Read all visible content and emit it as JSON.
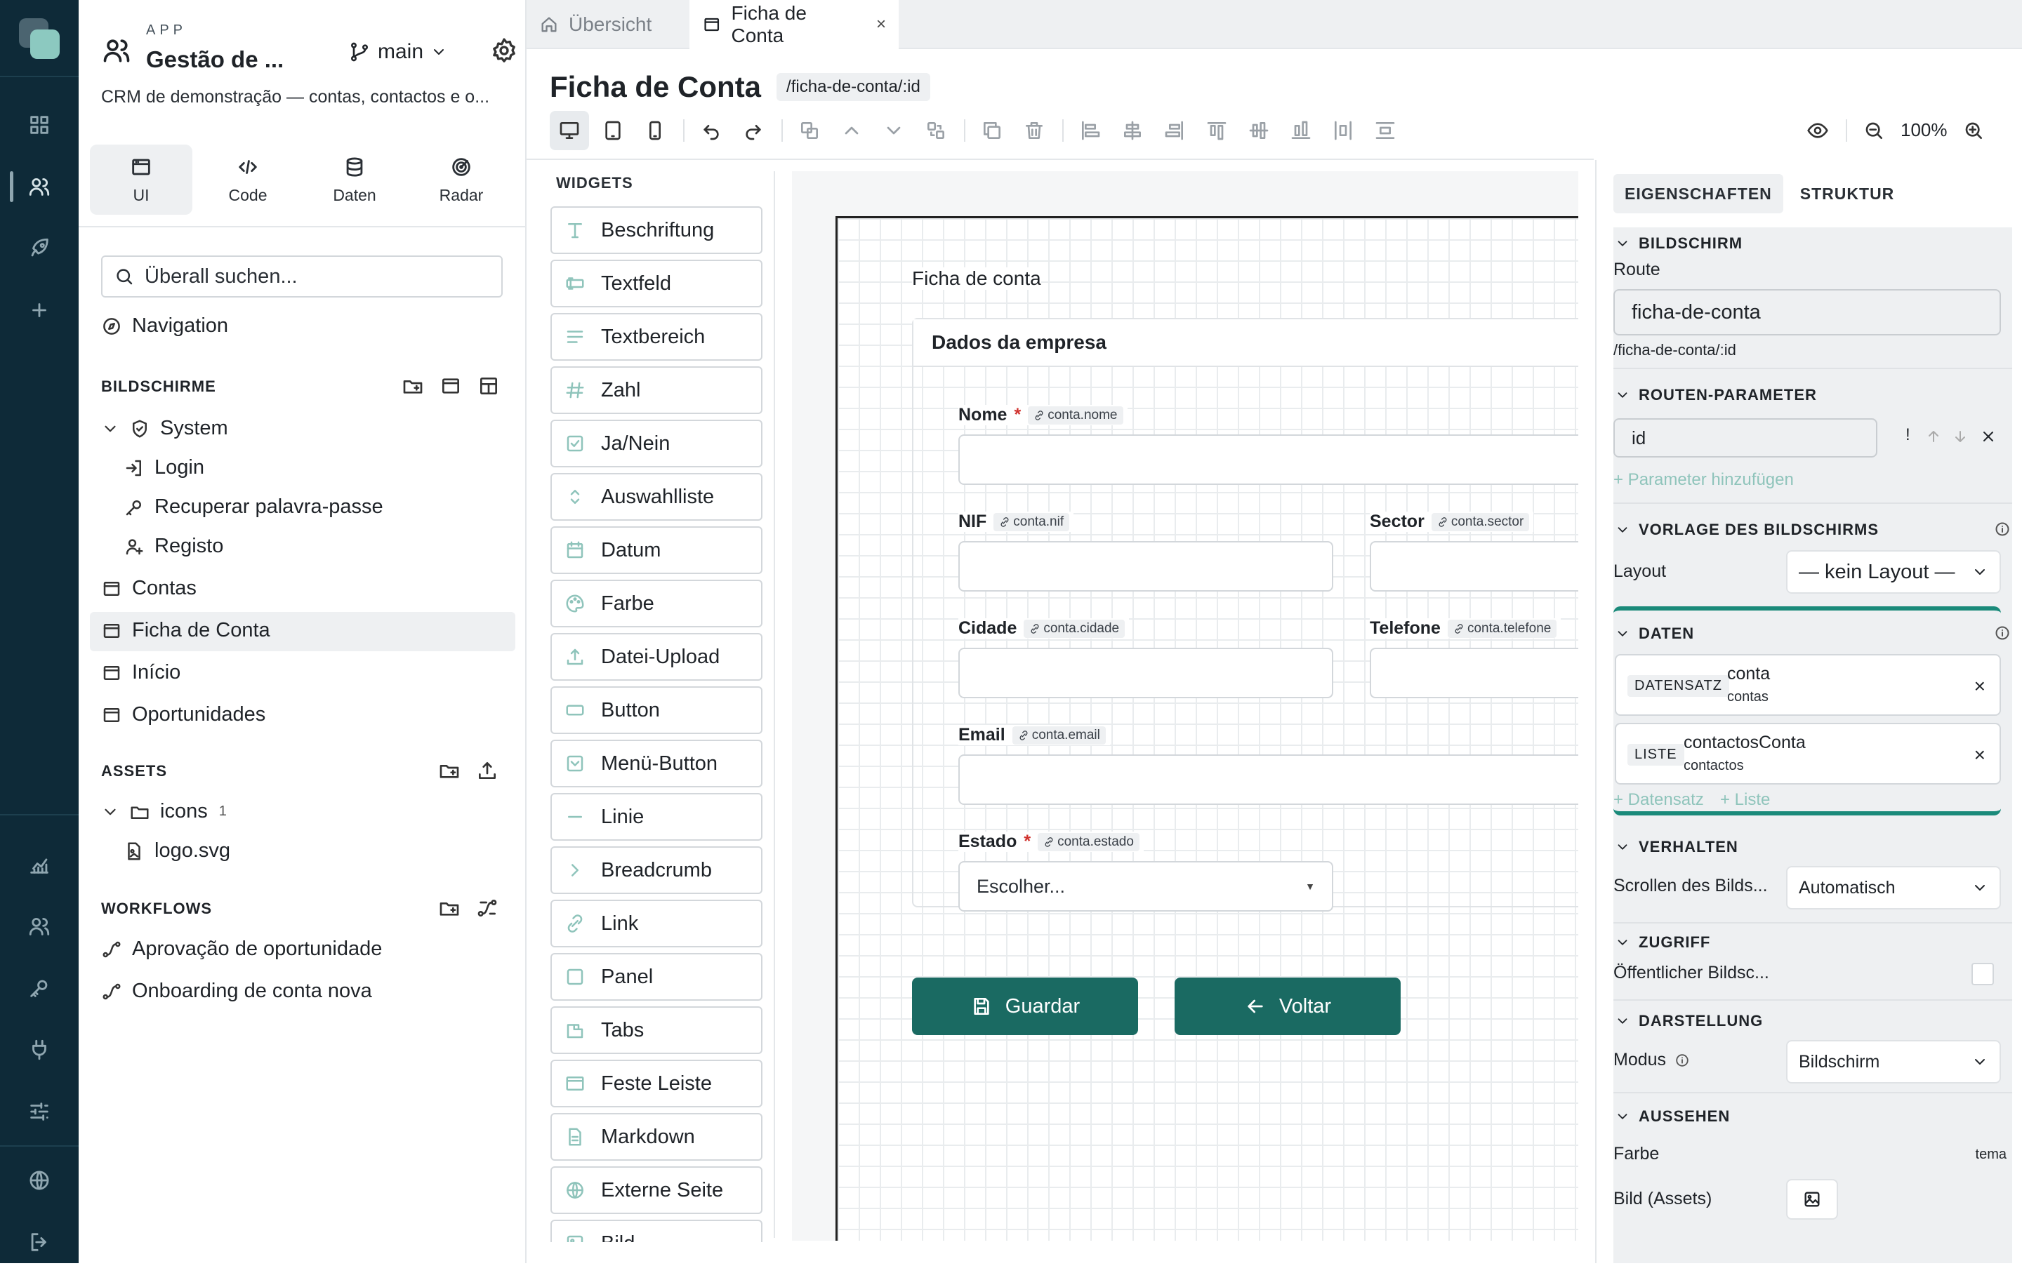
{
  "sidebar": {
    "app_label": "APP",
    "app_name": "Gestão de ...",
    "branch": "main",
    "description": "CRM de demonstração — contas, contactos e o...",
    "modes": [
      "UI",
      "Code",
      "Daten",
      "Radar"
    ],
    "search_placeholder": "Überall suchen...",
    "navigation": "Navigation",
    "screens_title": "BILDSCHIRME",
    "system_folder": "System",
    "system_items": [
      "Login",
      "Recuperar palavra-passe",
      "Registo"
    ],
    "screens": [
      "Contas",
      "Ficha de Conta",
      "Início",
      "Oportunidades"
    ],
    "assets_title": "ASSETS",
    "icons_folder": "icons",
    "icons_count": "1",
    "asset_file": "logo.svg",
    "workflows_title": "WORKFLOWS",
    "workflows": [
      "Aprovação de oportunidade",
      "Onboarding de conta nova"
    ]
  },
  "tabs": [
    {
      "label": "Übersicht"
    },
    {
      "label": "Ficha de Conta",
      "close": "×"
    }
  ],
  "page": {
    "title": "Ficha de Conta",
    "route": "/ficha-de-conta/:id",
    "zoom": "100%"
  },
  "widgets": {
    "title": "WIDGETS",
    "items": [
      "Beschriftung",
      "Textfeld",
      "Textbereich",
      "Zahl",
      "Ja/Nein",
      "Auswahlliste",
      "Datum",
      "Farbe",
      "Datei-Upload",
      "Button",
      "Menü-Button",
      "Linie",
      "Breadcrumb",
      "Link",
      "Panel",
      "Tabs",
      "Feste Leiste",
      "Markdown",
      "Externe Seite",
      "Bild"
    ]
  },
  "canvas": {
    "heading": "Ficha de conta",
    "card_title": "Dados da empresa",
    "fields": {
      "nome": {
        "label": "Nome",
        "bind": "conta.nome"
      },
      "nif": {
        "label": "NIF",
        "bind": "conta.nif"
      },
      "sector": {
        "label": "Sector",
        "bind": "conta.sector"
      },
      "cidade": {
        "label": "Cidade",
        "bind": "conta.cidade"
      },
      "telefone": {
        "label": "Telefone",
        "bind": "conta.telefone"
      },
      "email": {
        "label": "Email",
        "bind": "conta.email"
      },
      "estado": {
        "label": "Estado",
        "bind": "conta.estado",
        "placeholder": "Escolher..."
      }
    },
    "required_mark": "*",
    "save_button": "Guardar",
    "back_button": "Voltar"
  },
  "properties": {
    "tabs": [
      "EIGENSCHAFTEN",
      "STRUKTUR"
    ],
    "screen_section": "BILDSCHIRM",
    "route_label": "Route",
    "route_value": "ficha-de-conta",
    "route_full": "/ficha-de-conta/:id",
    "params_section": "ROUTEN-PARAMETER",
    "param_value": "id",
    "param_flag": "!",
    "add_param": "+ Parameter hinzufügen",
    "template_section": "VORLAGE DES BILDSCHIRMS",
    "layout_label": "Layout",
    "layout_value": "— kein Layout —",
    "data_section": "DATEN",
    "data_items": [
      {
        "tag": "DATENSATZ",
        "name": "conta",
        "source": "contas"
      },
      {
        "tag": "LISTE",
        "name": "contactosConta",
        "source": "contactos"
      }
    ],
    "add_record": "+ Datensatz",
    "add_list": "+ Liste",
    "behavior_section": "VERHALTEN",
    "scroll_label": "Scrollen des Bilds...",
    "scroll_value": "Automatisch",
    "access_section": "ZUGRIFF",
    "public_label": "Öffentlicher Bildsc...",
    "display_section": "DARSTELLUNG",
    "mode_label": "Modus",
    "mode_value": "Bildschirm",
    "appearance_section": "AUSSEHEN",
    "color_label": "Farbe",
    "color_value": "tema",
    "image_label": "Bild (Assets)"
  },
  "colors": {
    "rail": "#0e2a38",
    "primary_button": "#1a6a62",
    "accent": "#8fc4bb",
    "required": "#d0312d"
  }
}
